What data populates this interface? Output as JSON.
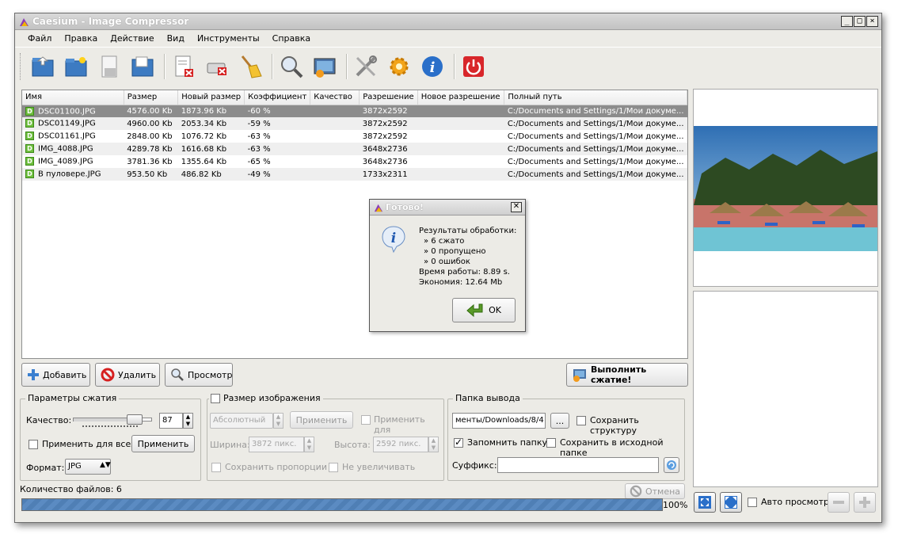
{
  "window": {
    "title": "Caesium - Image Compressor",
    "controls": [
      "_",
      "□",
      "×"
    ]
  },
  "menu": [
    "Файл",
    "Правка",
    "Действие",
    "Вид",
    "Инструменты",
    "Справка"
  ],
  "toolbar_icons": [
    "open-folder-icon",
    "new-folder-icon",
    "save-icon",
    "save-all-icon",
    "clear-list-icon",
    "remove-drive-icon",
    "broom-icon",
    "search-icon",
    "preview-image-icon",
    "tools-icon",
    "settings-gear-icon",
    "info-icon",
    "power-icon"
  ],
  "table": {
    "columns": [
      "Имя",
      "Размер",
      "Новый размер",
      "Коэффициент",
      "Качество",
      "Разрешение",
      "Новое разрешение",
      "Полный путь"
    ],
    "rows": [
      [
        "DSC01100.JPG",
        "4576.00 Kb",
        "1873.96 Kb",
        "-60 %",
        "",
        "3872x2592",
        "",
        "C:/Documents and Settings/1/Мои докуме..."
      ],
      [
        "DSC01149.JPG",
        "4960.00 Kb",
        "2053.34 Kb",
        "-59 %",
        "",
        "3872x2592",
        "",
        "C:/Documents and Settings/1/Мои докуме..."
      ],
      [
        "DSC01161.JPG",
        "2848.00 Kb",
        "1076.72 Kb",
        "-63 %",
        "",
        "3872x2592",
        "",
        "C:/Documents and Settings/1/Мои докуме..."
      ],
      [
        "IMG_4088.JPG",
        "4289.78 Kb",
        "1616.68 Kb",
        "-63 %",
        "",
        "3648x2736",
        "",
        "C:/Documents and Settings/1/Мои докуме..."
      ],
      [
        "IMG_4089.JPG",
        "3781.36 Kb",
        "1355.64 Kb",
        "-65 %",
        "",
        "3648x2736",
        "",
        "C:/Documents and Settings/1/Мои докуме..."
      ],
      [
        "В пуловере.JPG",
        "953.50 Kb",
        "486.82 Kb",
        "-49 %",
        "",
        "1733x2311",
        "",
        "C:/Documents and Settings/1/Мои докуме..."
      ]
    ],
    "row_badge": "D"
  },
  "buttons": {
    "add": "Добавить",
    "delete": "Удалить",
    "preview": "Просмотр",
    "compress": "Выполнить сжатие!"
  },
  "compression": {
    "title": "Параметры сжатия",
    "quality_label": "Качество:",
    "quality_value": "87",
    "apply_all_label": "Применить для всех",
    "apply_label": "Применить",
    "format_label": "Формат:",
    "format_value": "JPG"
  },
  "resize": {
    "title": "Размер изображения",
    "mode_value": "Абсолютный",
    "apply_label": "Применить",
    "apply_for_label": "Применить для",
    "width_label": "Ширина:",
    "width_value": "3872 пикс.",
    "height_label": "Высота:",
    "height_value": "2592 пикс.",
    "keep_ratio_label": "Сохранить пропорции",
    "no_enlarge_label": "Не увеличивать"
  },
  "output": {
    "title": "Папка вывода",
    "path_value": "менты/Downloads/8/4",
    "browse_label": "...",
    "keep_structure_label": "Сохранить структуру",
    "remember_folder_label": "Запомнить папку",
    "save_in_source_label": "Сохранить в исходной папке",
    "suffix_label": "Суффикс:",
    "suffix_value": ""
  },
  "status": {
    "file_count": "Количество файлов: 6",
    "cancel_label": "Отмена",
    "progress_percent": 100,
    "progress_text": "100%"
  },
  "preview": {
    "auto_preview_label": "Авто просмотр"
  },
  "dialog": {
    "title": "Готово!",
    "lines": [
      "Результаты обработки:",
      "» 6 сжато",
      "» 0 пропущено",
      "» 0 ошибок",
      "Время работы: 8.89 s.",
      "Экономия: 12.64 Mb"
    ],
    "ok_label": "OK"
  }
}
